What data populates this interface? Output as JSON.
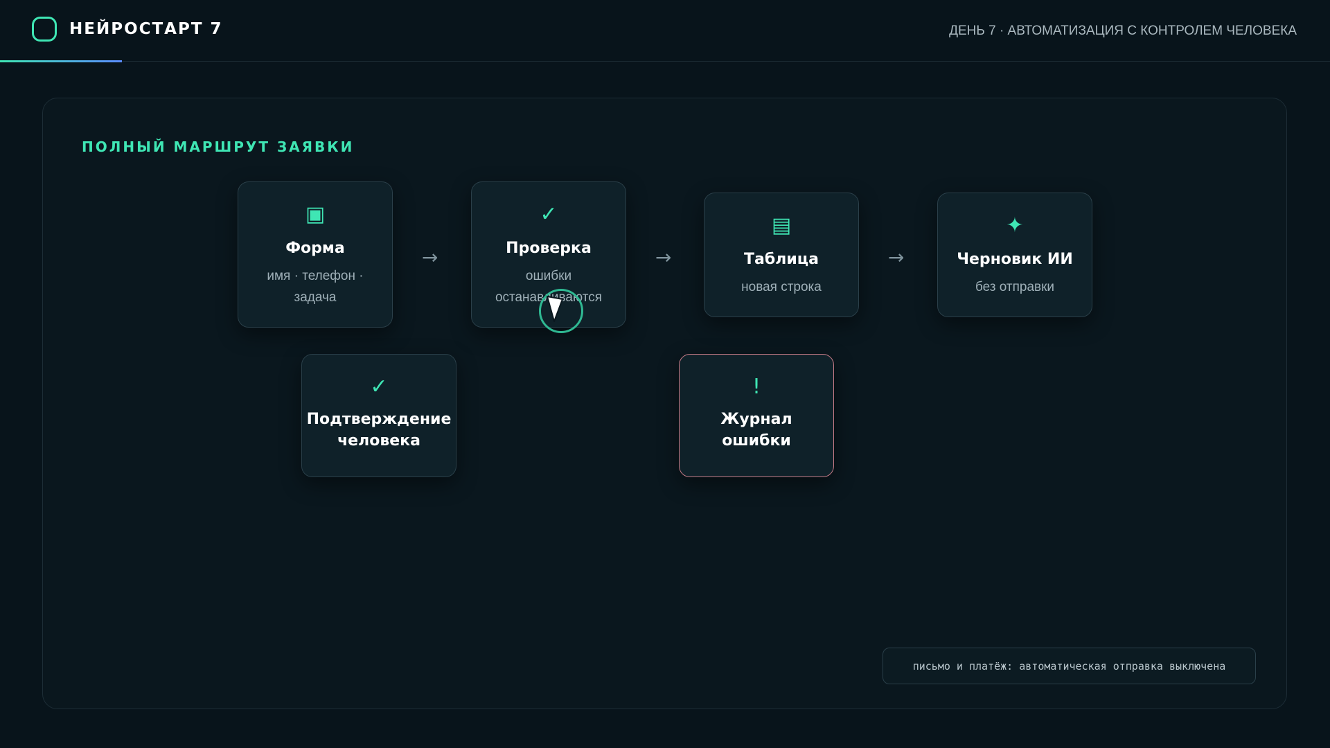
{
  "header": {
    "brand": "НЕЙРОСТАРТ 7",
    "day_title": "ДЕНЬ 7 · АВТОМАТИЗАЦИЯ С КОНТРОЛЕМ ЧЕЛОВЕКА"
  },
  "panel": {
    "title": "ПОЛНЫЙ МАРШРУТ ЗАЯВКИ",
    "nodes": {
      "form": {
        "icon": "form-icon",
        "glyph": "▣",
        "title": "Форма",
        "sub1": "имя · телефон ·",
        "sub2": "задача"
      },
      "check": {
        "icon": "check-icon",
        "glyph": "✓",
        "title": "Проверка",
        "sub1": "ошибки",
        "sub2": "останавливаются"
      },
      "table": {
        "icon": "table-icon",
        "glyph": "▤",
        "title": "Таблица",
        "sub1": "новая строка"
      },
      "draft": {
        "icon": "sparkle-icon",
        "glyph": "✦",
        "title": "Черновик ИИ",
        "sub1": "без отправки"
      },
      "confirm": {
        "icon": "check-icon",
        "glyph": "✓",
        "title1": "Подтверждение",
        "title2": "человека"
      },
      "errorlog": {
        "icon": "exclamation-icon",
        "glyph": "!",
        "title1": "Журнал",
        "title2": "ошибки"
      }
    },
    "arrow_glyph": "→",
    "note": "письмо и платёж: автоматическая отправка выключена"
  },
  "colors": {
    "accent": "#3fe6b4",
    "background": "#08141b",
    "danger_border": "#c47a86"
  }
}
